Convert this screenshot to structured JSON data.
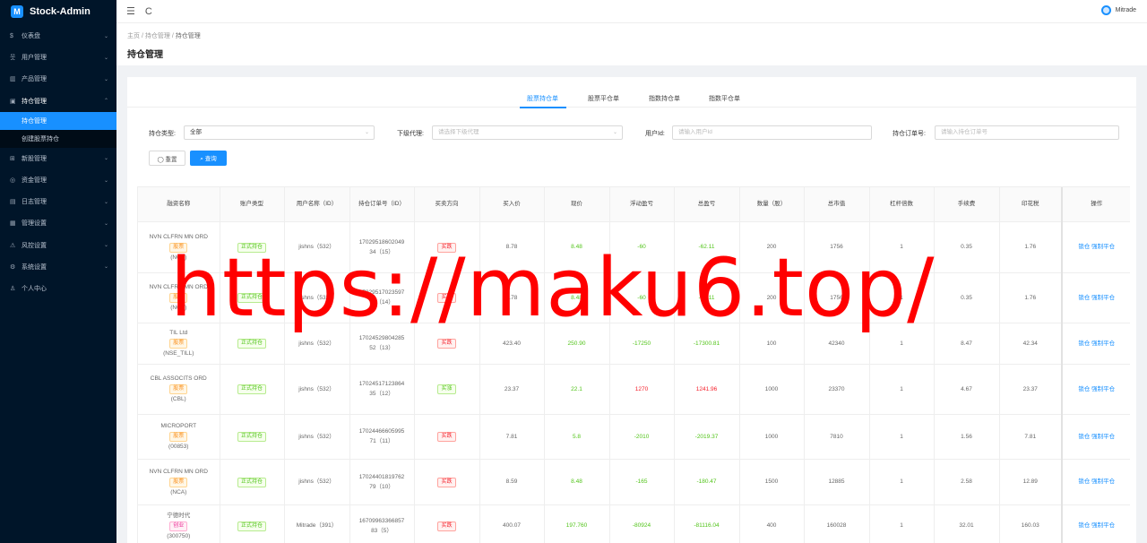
{
  "app": {
    "logo_icon": "M",
    "title": "Stock-Admin"
  },
  "sidebar": {
    "items": [
      {
        "icon": "$",
        "label": "仪表盘",
        "arrow": "⌄"
      },
      {
        "icon": "웃",
        "label": "用户管理",
        "arrow": "⌄"
      },
      {
        "icon": "▥",
        "label": "产品管理",
        "arrow": "⌄"
      },
      {
        "icon": "▣",
        "label": "持仓管理",
        "arrow": "⌃"
      },
      {
        "icon": "⊞",
        "label": "新股管理",
        "arrow": "⌄"
      },
      {
        "icon": "◎",
        "label": "资金管理",
        "arrow": "⌄"
      },
      {
        "icon": "▤",
        "label": "日志管理",
        "arrow": "⌄"
      },
      {
        "icon": "▦",
        "label": "管理设置",
        "arrow": "⌄"
      },
      {
        "icon": "⚠",
        "label": "风控设置",
        "arrow": "⌄"
      },
      {
        "icon": "⚙",
        "label": "系统设置",
        "arrow": "⌄"
      },
      {
        "icon": "♙",
        "label": "个人中心",
        "arrow": ""
      }
    ],
    "sub_items": [
      {
        "label": "持仓管理"
      },
      {
        "label": "创建股票持仓"
      }
    ]
  },
  "header": {
    "menu_icon": "☰",
    "refresh_icon": "C",
    "username": "Mitrade"
  },
  "breadcrumb": [
    "主页",
    "持仓管理",
    "持仓管理"
  ],
  "breadcrumb_sep": "/",
  "page_title": "持仓管理",
  "tabs": [
    "股票持仓单",
    "股票平仓单",
    "指数持仓单",
    "指数平仓单"
  ],
  "filters": {
    "type_label": "持仓类型:",
    "type_value": "全部",
    "agent_label": "下级代理:",
    "agent_placeholder": "请选择下级代理",
    "userid_label": "用户Id:",
    "userid_placeholder": "请输入用户Id",
    "order_label": "持仓订单号:",
    "order_placeholder": "请输入持仓订单号",
    "caret": "⌄"
  },
  "buttons": {
    "reset": "◯ 重置",
    "search": "⌕ 查询"
  },
  "table": {
    "headers": [
      "融资名称",
      "账户类型",
      "用户名称（ID）",
      "持仓订单号（ID）",
      "买卖方向",
      "买入价",
      "现价",
      "浮动盈亏",
      "总盈亏",
      "数量（股）",
      "总市值",
      "杠杆倍数",
      "手续费",
      "印花税",
      "操作"
    ],
    "rows": [
      {
        "name": "NVN CLFRN MN ORD",
        "tag": "股票",
        "tag_type": "hk",
        "code": "(NCA)",
        "account": "正式持仓",
        "user": "jishns（532）",
        "order1": "17029518602049",
        "order2": "34（15）",
        "direction": "买跌",
        "dir_type": "red",
        "buy": "8.78",
        "now": "8.48",
        "float": "-60",
        "float_color": "green",
        "total": "-62.11",
        "total_color": "green",
        "qty": "200",
        "mv": "1756",
        "lev": "1",
        "fee": "0.35",
        "stamp": "1.76",
        "op1": "锁仓",
        "op2": "强制平仓"
      },
      {
        "name": "NVN CLFRN MN ORD",
        "tag": "股票",
        "tag_type": "hk",
        "code": "(NCA)",
        "account": "正式持仓",
        "user": "jishns（532）",
        "order1": "17029517023597",
        "order2": "72（14）",
        "direction": "买跌",
        "dir_type": "red",
        "buy": "8.78",
        "now": "8.48",
        "float": "-60",
        "float_color": "green",
        "total": "-62.11",
        "total_color": "green",
        "qty": "200",
        "mv": "1756",
        "lev": "1",
        "fee": "0.35",
        "stamp": "1.76",
        "op1": "锁仓",
        "op2": "强制平仓"
      },
      {
        "name": "TIL Ltd",
        "tag": "股票",
        "tag_type": "hk",
        "code": "(NSE_TILL)",
        "account": "正式持仓",
        "user": "jishns（532）",
        "order1": "17024529804285",
        "order2": "52（13）",
        "direction": "买跌",
        "dir_type": "red",
        "buy": "423.40",
        "now": "250.90",
        "float": "-17250",
        "float_color": "green",
        "total": "-17300.81",
        "total_color": "green",
        "qty": "100",
        "mv": "42340",
        "lev": "1",
        "fee": "8.47",
        "stamp": "42.34",
        "op1": "锁仓",
        "op2": "强制平仓"
      },
      {
        "name": "CBL ASSOCITS ORD",
        "tag": "股票",
        "tag_type": "hk",
        "code": "(CBL)",
        "account": "正式持仓",
        "user": "jishns（532）",
        "order1": "17024517123864",
        "order2": "35（12）",
        "direction": "买涨",
        "dir_type": "green",
        "buy": "23.37",
        "now": "22.1",
        "float": "1270",
        "float_color": "red",
        "total": "1241.96",
        "total_color": "red",
        "qty": "1000",
        "mv": "23370",
        "lev": "1",
        "fee": "4.67",
        "stamp": "23.37",
        "op1": "锁仓",
        "op2": "强制平仓"
      },
      {
        "name": "MICROPORT",
        "tag": "股票",
        "tag_type": "hk",
        "code": "(00853)",
        "account": "正式持仓",
        "user": "jishns（532）",
        "order1": "17024466605995",
        "order2": "71（11）",
        "direction": "买跌",
        "dir_type": "red",
        "buy": "7.81",
        "now": "5.8",
        "float": "-2010",
        "float_color": "green",
        "total": "-2019.37",
        "total_color": "green",
        "qty": "1000",
        "mv": "7810",
        "lev": "1",
        "fee": "1.56",
        "stamp": "7.81",
        "op1": "锁仓",
        "op2": "强制平仓"
      },
      {
        "name": "NVN CLFRN MN ORD",
        "tag": "股票",
        "tag_type": "hk",
        "code": "(NCA)",
        "account": "正式持仓",
        "user": "jishns（532）",
        "order1": "17024401819762",
        "order2": "79（10）",
        "direction": "买跌",
        "dir_type": "red",
        "buy": "8.59",
        "now": "8.48",
        "float": "-165",
        "float_color": "green",
        "total": "-180.47",
        "total_color": "green",
        "qty": "1500",
        "mv": "12885",
        "lev": "1",
        "fee": "2.58",
        "stamp": "12.89",
        "op1": "锁仓",
        "op2": "强制平仓"
      },
      {
        "name": "宁德时代",
        "tag": "创业",
        "tag_type": "sz",
        "code": "(300750)",
        "account": "正式持仓",
        "user": "Mitrade（391）",
        "order1": "16709963366857",
        "order2": "83（5）",
        "direction": "买跌",
        "dir_type": "red",
        "buy": "400.07",
        "now": "197.760",
        "float": "-80924",
        "float_color": "green",
        "total": "-81116.04",
        "total_color": "green",
        "qty": "400",
        "mv": "160028",
        "lev": "1",
        "fee": "32.01",
        "stamp": "160.03",
        "op1": "锁仓",
        "op2": "强制平仓"
      }
    ]
  },
  "watermark": "https://maku6.top/"
}
